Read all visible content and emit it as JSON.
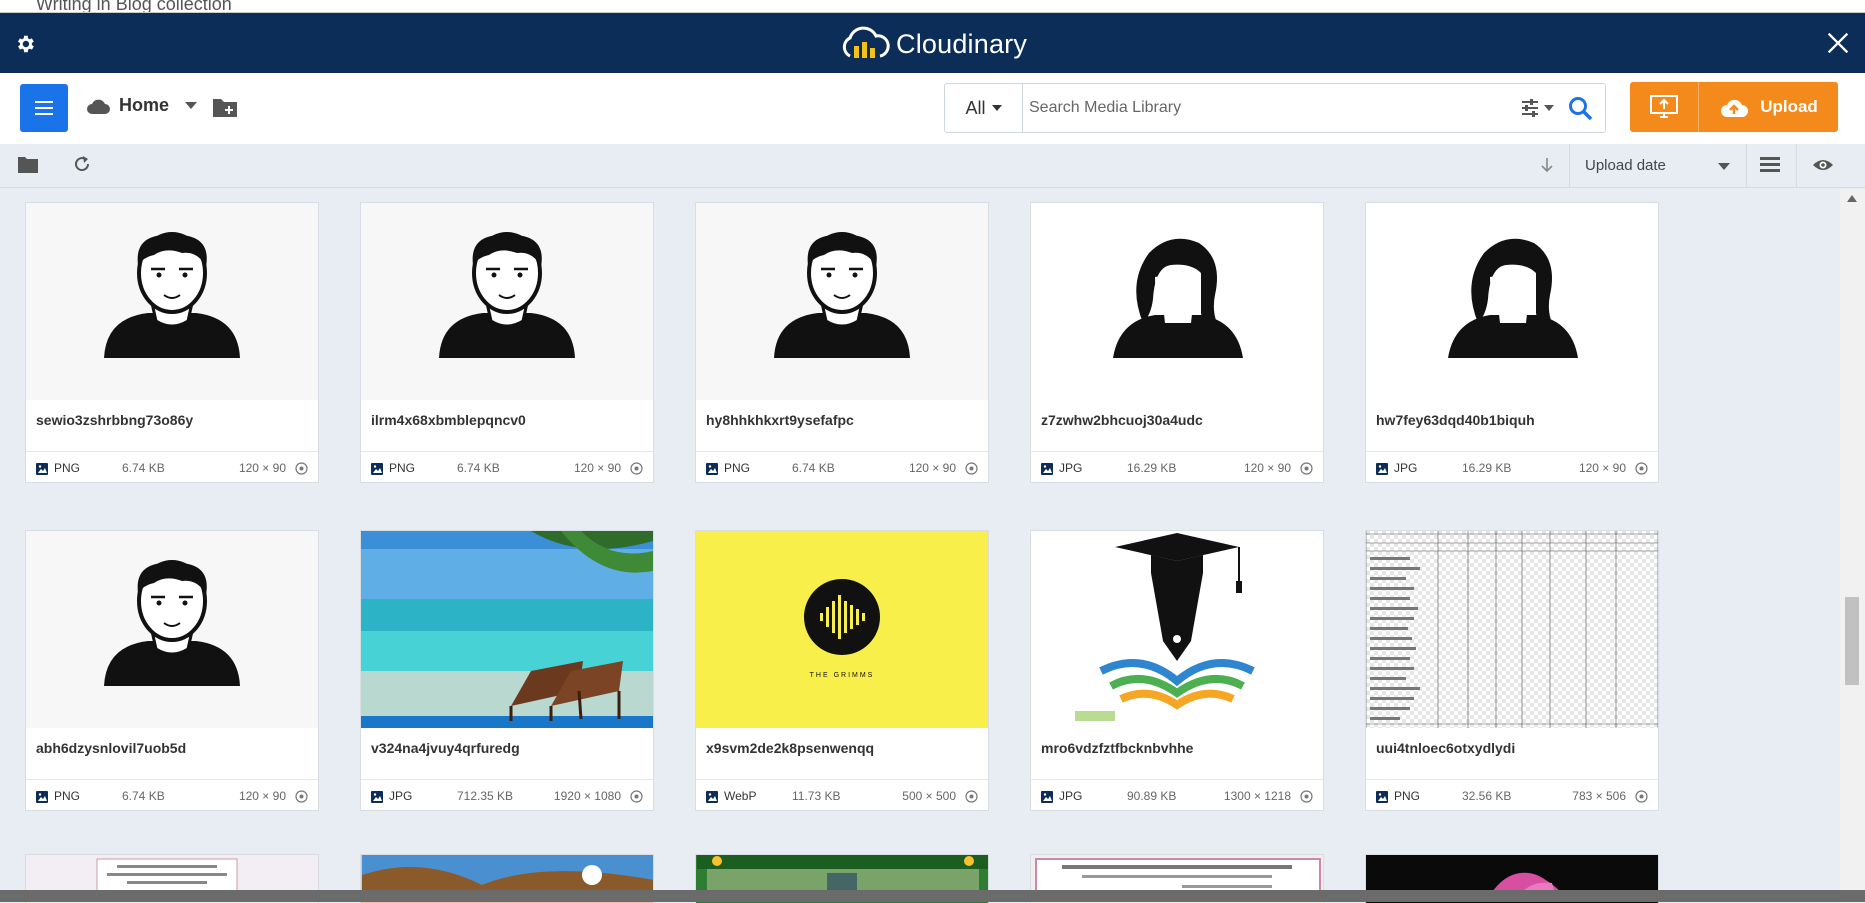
{
  "background_page": {
    "title": "Writing in Blog collection"
  },
  "header": {
    "brand": "Cloudinary",
    "bg_color": "#0c2d57"
  },
  "toolbar": {
    "folder": "Home",
    "search": {
      "scope": "All",
      "placeholder": "Search Media Library"
    },
    "upload_label": "Upload",
    "accent_color": "#f38a1b",
    "menu_color": "#1a73e8"
  },
  "subbar": {
    "sort_by": "Upload date"
  },
  "assets": [
    {
      "name": "sewio3zshrbbng73o86y",
      "format": "PNG",
      "size": "6.74 KB",
      "dims": "120 × 90",
      "thumb": "male-avatar"
    },
    {
      "name": "ilrm4x68xbmblepqncv0",
      "format": "PNG",
      "size": "6.74 KB",
      "dims": "120 × 90",
      "thumb": "male-avatar"
    },
    {
      "name": "hy8hhkhkxrt9ysefafpc",
      "format": "PNG",
      "size": "6.74 KB",
      "dims": "120 × 90",
      "thumb": "male-avatar"
    },
    {
      "name": "z7zwhw2bhcuoj30a4udc",
      "format": "JPG",
      "size": "16.29 KB",
      "dims": "120 × 90",
      "thumb": "female-avatar"
    },
    {
      "name": "hw7fey63dqd40b1biquh",
      "format": "JPG",
      "size": "16.29 KB",
      "dims": "120 × 90",
      "thumb": "female-avatar"
    },
    {
      "name": "abh6dzysnlovil7uob5d",
      "format": "PNG",
      "size": "6.74 KB",
      "dims": "120 × 90",
      "thumb": "male-avatar"
    },
    {
      "name": "v324na4jvuy4qrfuredg",
      "format": "JPG",
      "size": "712.35 KB",
      "dims": "1920 × 1080",
      "thumb": "beach"
    },
    {
      "name": "x9svm2de2k8psenwenqq",
      "format": "WebP",
      "size": "11.73 KB",
      "dims": "500 × 500",
      "thumb": "grimms"
    },
    {
      "name": "mro6vdzfztfbcknbvhhe",
      "format": "JPG",
      "size": "90.89 KB",
      "dims": "1300 × 1218",
      "thumb": "graduation"
    },
    {
      "name": "uui4tnloec6otxydlydi",
      "format": "PNG",
      "size": "32.56 KB",
      "dims": "783 × 506",
      "thumb": "spreadsheet"
    }
  ],
  "thumb_text": {
    "grimms": "THE GRIMMS"
  }
}
